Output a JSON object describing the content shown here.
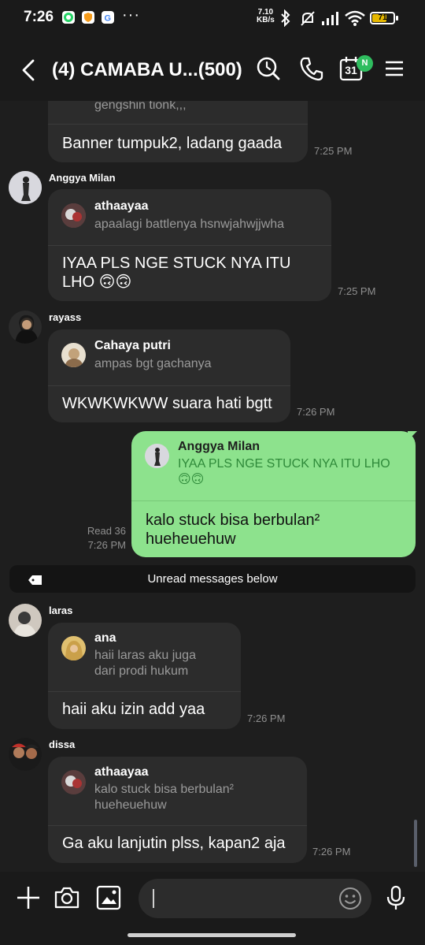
{
  "status_bar": {
    "time": "7:26",
    "dots": "···",
    "speed_value": "7.10",
    "speed_unit": "KB/s",
    "battery_level": "71",
    "battery_fraction": 0.71
  },
  "header": {
    "title": "(4) CAMABA U...(500)",
    "calendar_day": "31",
    "calendar_badge": "N"
  },
  "messages": [
    {
      "sender": "",
      "quote_text": "gengshin tionk,,,",
      "text": "Banner tumpuk2, ladang gaada",
      "time": "7:25 PM"
    },
    {
      "sender": "Anggya Milan",
      "quote_name": "athaayaa",
      "quote_text": "apaalagi battlenya hsnwjahwjjwha",
      "text_line1": "IYAA PLS NGE STUCK NYA ITU",
      "text_line2": "LHO 🙃🙃",
      "time": "7:25 PM"
    },
    {
      "sender": "rayass",
      "quote_name": "Cahaya putri",
      "quote_text": "ampas bgt gachanya",
      "text": "WKWKWKWW suara hati bgtt",
      "time": "7:26 PM"
    },
    {
      "sender": "me",
      "quote_name": "Anggya Milan",
      "quote_text_line1": "IYAA PLS NGE STUCK NYA ITU LHO",
      "quote_text_line2": "🙃🙃",
      "text_line1": "kalo stuck bisa berbulan²",
      "text_line2": "hueheuehuw",
      "read": "Read 36",
      "time": "7:26 PM"
    },
    {
      "sender": "laras",
      "quote_name": "ana",
      "quote_text_line1": "haii laras aku juga",
      "quote_text_line2": "dari prodi hukum",
      "text": "haii aku izin add yaa",
      "time": "7:26 PM"
    },
    {
      "sender": "dissa",
      "quote_name": "athaayaa",
      "quote_text_line1": "kalo stuck bisa berbulan²",
      "quote_text_line2": "hueheuehuw",
      "text": "Ga aku lanjutin plss, kapan2 aja",
      "time": "7:26 PM"
    }
  ],
  "unread_banner": "Unread messages below",
  "input": {
    "value": ""
  },
  "icons": {
    "back": "chevron-left-icon",
    "search": "search-icon",
    "call": "phone-icon",
    "calendar": "calendar-icon",
    "menu": "hamburger-menu-icon",
    "add": "plus-icon",
    "camera": "camera-icon",
    "gallery": "image-icon",
    "emoji": "emoji-icon",
    "mic": "microphone-icon"
  },
  "colors": {
    "background": "#1e1e1e",
    "bubble": "#2c2c2c",
    "own_bubble": "#8de28d",
    "badge": "#2fbd5f",
    "battery": "#e6b800"
  }
}
